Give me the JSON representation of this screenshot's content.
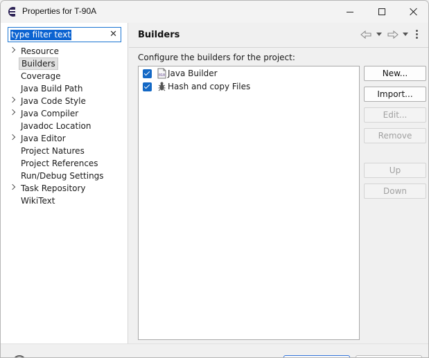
{
  "window": {
    "title": "Properties for T-90A",
    "icon": "eclipse-icon"
  },
  "filter": {
    "value": "type filter text",
    "clear_icon": "✕"
  },
  "nav": {
    "items": [
      {
        "label": "Resource",
        "expandable": true,
        "selected": false
      },
      {
        "label": "Builders",
        "expandable": false,
        "selected": true
      },
      {
        "label": "Coverage",
        "expandable": false,
        "selected": false
      },
      {
        "label": "Java Build Path",
        "expandable": false,
        "selected": false
      },
      {
        "label": "Java Code Style",
        "expandable": true,
        "selected": false
      },
      {
        "label": "Java Compiler",
        "expandable": true,
        "selected": false
      },
      {
        "label": "Javadoc Location",
        "expandable": false,
        "selected": false
      },
      {
        "label": "Java Editor",
        "expandable": true,
        "selected": false
      },
      {
        "label": "Project Natures",
        "expandable": false,
        "selected": false
      },
      {
        "label": "Project References",
        "expandable": false,
        "selected": false
      },
      {
        "label": "Run/Debug Settings",
        "expandable": false,
        "selected": false
      },
      {
        "label": "Task Repository",
        "expandable": true,
        "selected": false
      },
      {
        "label": "WikiText",
        "expandable": false,
        "selected": false
      }
    ]
  },
  "page": {
    "title": "Builders",
    "instructions": "Configure the builders for the project:"
  },
  "builders": [
    {
      "label": "Java Builder",
      "checked": true,
      "icon": "java-builder-icon"
    },
    {
      "label": "Hash and copy Files",
      "checked": true,
      "icon": "external-tool-builder-icon"
    }
  ],
  "buttons": {
    "new": "New...",
    "import": "Import...",
    "edit": "Edit...",
    "remove": "Remove",
    "up": "Up",
    "down": "Down"
  },
  "colors": {
    "accent": "#1368c5",
    "selection": "#0b63d1"
  }
}
